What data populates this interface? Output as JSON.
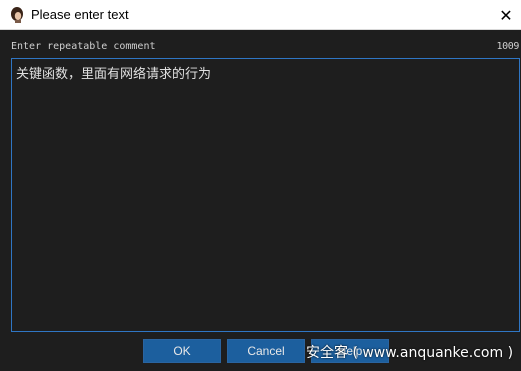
{
  "window": {
    "title": "Please enter text",
    "icon": "app-avatar-icon",
    "close_icon": "close-icon"
  },
  "prompt": {
    "label": "Enter repeatable comment",
    "counter": "1009"
  },
  "editor": {
    "value": "关键函数，里面有网络请求的行为"
  },
  "buttons": {
    "ok": "OK",
    "cancel": "Cancel",
    "help": "Help"
  },
  "watermark": {
    "text": "安全客 ( www.anquanke.com )"
  },
  "colors": {
    "background": "#1e1e1e",
    "accent_border": "#2f76c4",
    "button_bg": "#1c5f9e"
  }
}
